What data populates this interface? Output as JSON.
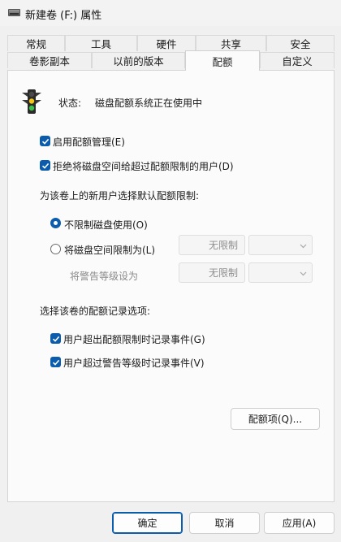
{
  "window": {
    "title": "新建卷 (F:) 属性"
  },
  "tabs": {
    "row1": [
      "常规",
      "工具",
      "硬件",
      "共享",
      "安全"
    ],
    "row2": [
      "卷影副本",
      "以前的版本",
      "配额",
      "自定义"
    ]
  },
  "quota": {
    "status_label": "状态:",
    "status_value": "磁盘配额系统正在使用中",
    "enable_quota": "启用配额管理(E)",
    "deny_space": "拒绝将磁盘空间给超过配额限制的用户(D)",
    "default_limit_heading": "为该卷上的新用户选择默认配额限制:",
    "no_limit": "不限制磁盘使用(O)",
    "limit_to": "将磁盘空间限制为(L)",
    "warning_level": "将警告等级设为",
    "limit_value": "无限制",
    "warning_value": "无限制",
    "logging_heading": "选择该卷的配额记录选项:",
    "log_exceed_limit": "用户超出配额限制时记录事件(G)",
    "log_exceed_warning": "用户超过警告等级时记录事件(V)",
    "entries_button": "配额项(Q)..."
  },
  "footer": {
    "ok": "确定",
    "cancel": "取消",
    "apply": "应用(A)"
  },
  "colors": {
    "accent": "#0b5cad",
    "disabled_text": "#8a8a8a"
  }
}
